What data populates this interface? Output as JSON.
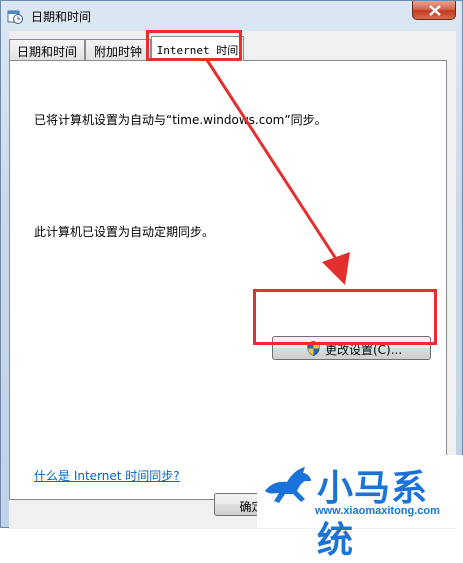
{
  "window": {
    "title": "日期和时间"
  },
  "tabs": [
    {
      "label": "日期和时间"
    },
    {
      "label": "附加时钟"
    },
    {
      "label": "Internet 时间"
    }
  ],
  "panel": {
    "sync_server_text": "已将计算机设置为自动与“time.windows.com”同步。",
    "auto_sync_text": "此计算机已设置为自动定期同步。",
    "change_settings_label": "更改设置(C)...",
    "help_link": "什么是 Internet 时间同步?"
  },
  "footer": {
    "ok_label": "确定"
  },
  "watermark": {
    "brand": "小马系统",
    "url": "www.xiaomaxitong.com"
  },
  "colors": {
    "annotation": "#e3302f",
    "link": "#0066cc",
    "watermark": "#1a73d8"
  },
  "icons": {
    "title": "date-time-icon",
    "close": "close-icon",
    "shield": "uac-shield-icon",
    "logo": "horse-logo-icon"
  }
}
